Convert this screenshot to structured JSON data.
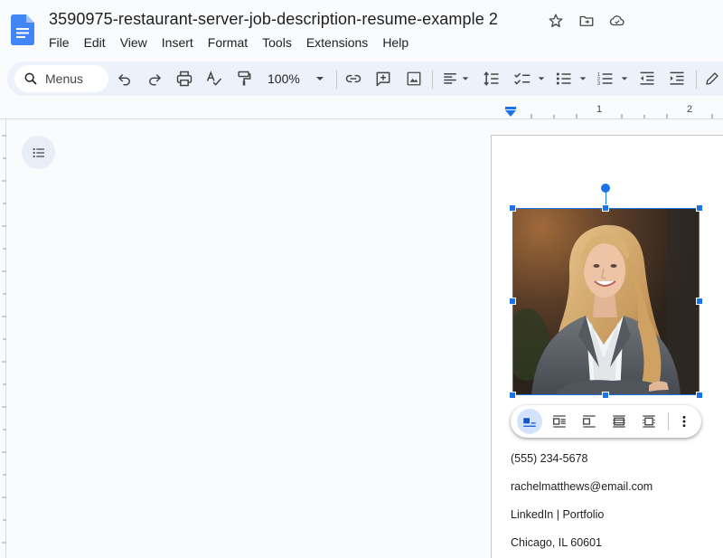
{
  "doc": {
    "title": "3590975-restaurant-server-job-description-resume-example 2"
  },
  "menubar": {
    "items": [
      "File",
      "Edit",
      "View",
      "Insert",
      "Format",
      "Tools",
      "Extensions",
      "Help"
    ]
  },
  "toolbar": {
    "search_label": "Menus",
    "zoom": "100%"
  },
  "ruler": {
    "numbers": [
      "1",
      "2"
    ]
  },
  "contact": {
    "phone": "(555) 234-5678",
    "email": "rachelmatthews@email.com",
    "links": "LinkedIn | Portfolio",
    "location": "Chicago, IL 60601"
  },
  "colors": {
    "accent": "#1a73e8",
    "toolbar_bg": "#edf2fa",
    "canvas_bg": "#f9fbfd"
  },
  "icons": {
    "app": "google-docs-icon",
    "star": "star-icon",
    "move": "move-to-folder-icon",
    "cloud": "cloud-status-icon"
  }
}
